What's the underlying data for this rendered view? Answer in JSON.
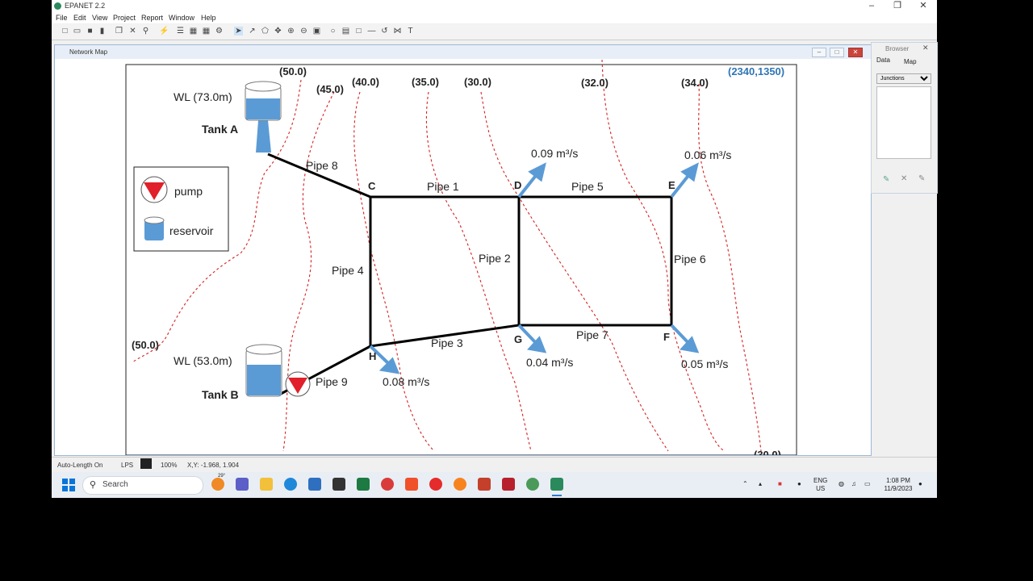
{
  "app": {
    "title": "EPANET 2.2"
  },
  "menu": [
    "File",
    "Edit",
    "View",
    "Project",
    "Report",
    "Window",
    "Help"
  ],
  "map_window": {
    "title": "Network Map"
  },
  "diagram": {
    "coord_label": "(2340,1350)",
    "elevations": [
      "(50.0)",
      "(45.0)",
      "(40.0)",
      "(35.0)",
      "(30.0)",
      "(32.0)",
      "(34.0)",
      "(50.0)",
      "(30.0)"
    ],
    "tank_a": {
      "name": "Tank A",
      "level": "WL (73.0m)"
    },
    "tank_b": {
      "name": "Tank B",
      "level": "WL (53.0m)"
    },
    "legend": {
      "pump": "pump",
      "reservoir": "reservoir"
    },
    "nodes": {
      "c": "C",
      "d": "D",
      "e": "E",
      "f": "F",
      "g": "G",
      "h": "H"
    },
    "pipes": {
      "p1": "Pipe 1",
      "p2": "Pipe 2",
      "p3": "Pipe 3",
      "p4": "Pipe 4",
      "p5": "Pipe 5",
      "p6": "Pipe 6",
      "p7": "Pipe 7",
      "p8": "Pipe 8",
      "p9": "Pipe 9"
    },
    "demands": {
      "d": "0.09 m³/s",
      "e": "0.06 m³/s",
      "g": "0.04 m³/s",
      "f": "0.05 m³/s",
      "h": "0.08 m³/s"
    }
  },
  "browser": {
    "title": "Browser",
    "tabs": [
      "Data",
      "Map"
    ],
    "category": "Junctions"
  },
  "status": {
    "auto_length": "Auto-Length On",
    "flow_units": "LPS",
    "zoom": "100%",
    "xy": "X,Y: -1.968, 1.904"
  },
  "taskbar": {
    "search": "Search",
    "temp": "29°",
    "lang1": "ENG",
    "lang2": "US",
    "time": "1:08 PM",
    "date": "11/9/2023"
  },
  "colors": {
    "pipe": "#000000",
    "demand_arrow": "#5b9bd5",
    "contour": "#d62020",
    "coord": "#2e75b6"
  }
}
